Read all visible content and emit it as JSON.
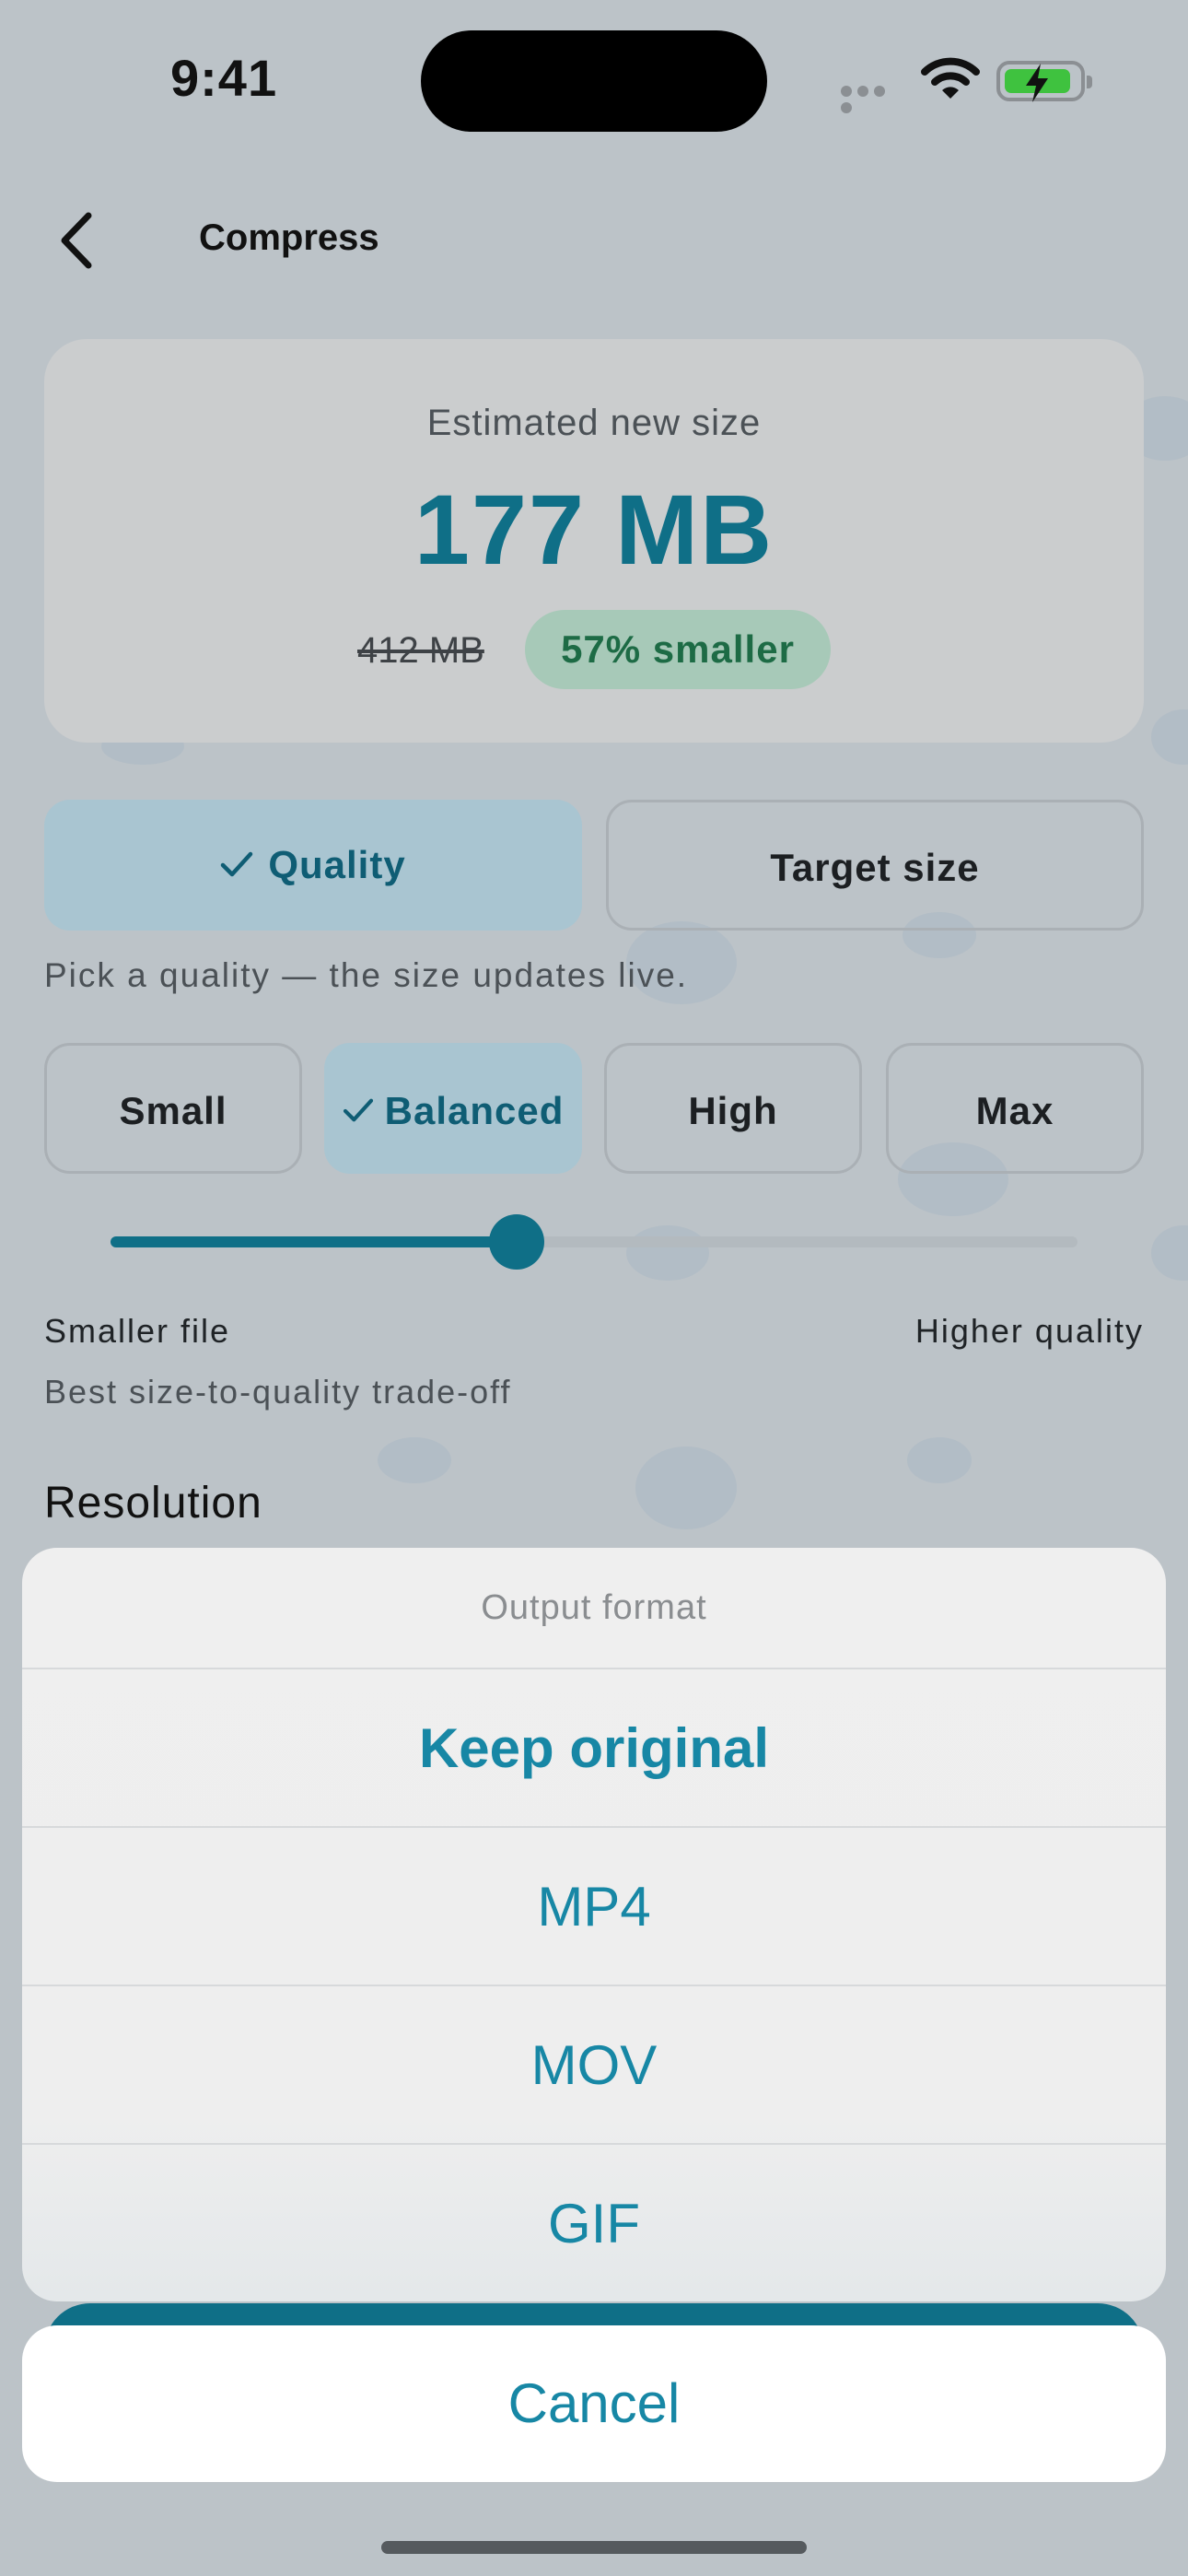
{
  "status_bar": {
    "time": "9:41"
  },
  "header": {
    "title": "Compress"
  },
  "size_card": {
    "label": "Estimated new size",
    "new_size": "177 MB",
    "original_size": "412 MB",
    "reduction_badge": "57% smaller"
  },
  "mode_toggle": {
    "options": [
      "Quality",
      "Target size"
    ],
    "selected": "Quality"
  },
  "hint": "Pick a quality — the size updates live.",
  "presets": {
    "options": [
      "Small",
      "Balanced",
      "High",
      "Max"
    ],
    "selected": "Balanced"
  },
  "quality_slider": {
    "value_fraction": 0.42,
    "min_label": "Smaller file",
    "max_label": "Higher quality",
    "description": "Best size-to-quality trade-off"
  },
  "section": {
    "resolution_title": "Resolution"
  },
  "action_sheet": {
    "title": "Output format",
    "options": [
      "Keep original",
      "MP4",
      "MOV",
      "GIF"
    ],
    "selected": "Keep original",
    "cancel_label": "Cancel"
  },
  "colors": {
    "accent": "#0f6f87",
    "sheet_option_text": "#1787a5",
    "success_badge_bg": "#a7c9b8",
    "success_badge_text": "#1d6b45"
  }
}
